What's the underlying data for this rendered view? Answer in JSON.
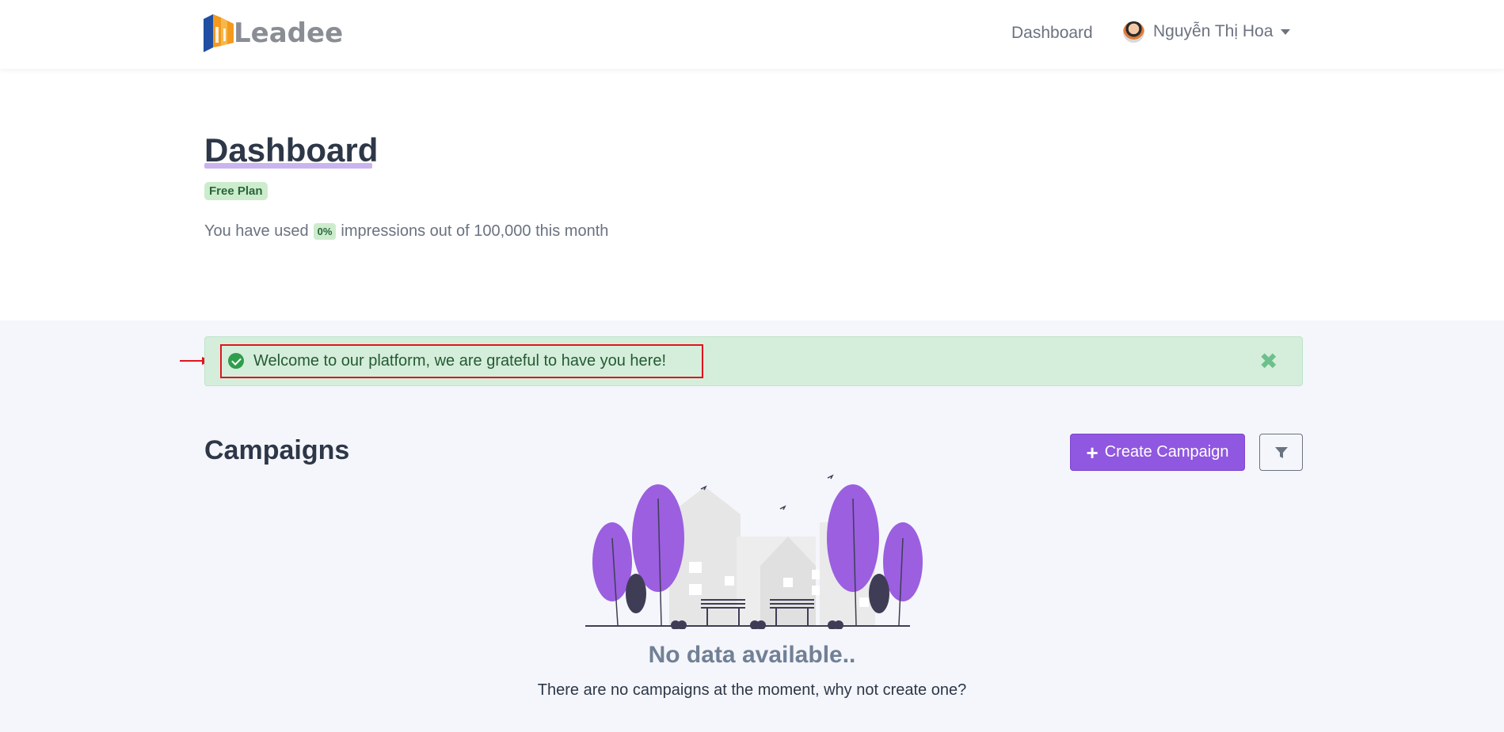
{
  "nav": {
    "logo_text": "Leadee",
    "dashboard_link": "Dashboard",
    "user_name": "Nguyễn Thị Hoa"
  },
  "header": {
    "title": "Dashboard",
    "plan_badge": "Free Plan",
    "usage_prefix": "You have used",
    "usage_percent": "0%",
    "usage_suffix": "impressions out of 100,000 this month"
  },
  "alert": {
    "message": "Welcome to our platform, we are grateful to have you here!",
    "close_symbol": "✖"
  },
  "campaigns": {
    "title": "Campaigns",
    "create_label": "Create Campaign",
    "create_icon": "+",
    "empty_title": "No data available..",
    "empty_subtitle": "There are no campaigns at the moment, why not create one?"
  },
  "colors": {
    "accent": "#9057e0",
    "success_bg": "#d5eedb",
    "highlight_border": "#e0141e"
  },
  "icons": [
    "leadee-logo",
    "avatar",
    "chevron-down-icon",
    "check-circle-icon",
    "close-icon",
    "plus-icon",
    "filter-icon",
    "empty-state-illustration"
  ]
}
